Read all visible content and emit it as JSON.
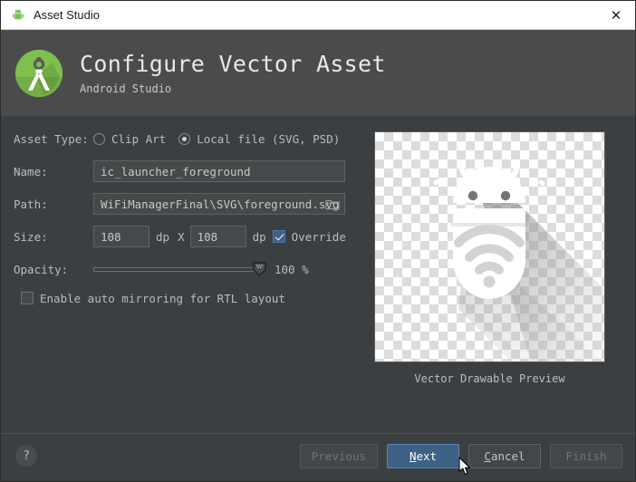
{
  "titlebar": {
    "title": "Asset Studio",
    "icon": "android-robot-icon",
    "close_label": "✕"
  },
  "header": {
    "title": "Configure Vector Asset",
    "subtitle": "Android Studio",
    "logo": "android-studio-logo"
  },
  "form": {
    "asset_type": {
      "label": "Asset Type:",
      "options": [
        {
          "label": "Clip Art",
          "selected": false
        },
        {
          "label": "Local file (SVG, PSD)",
          "selected": true
        }
      ]
    },
    "name": {
      "label": "Name:",
      "value": "ic_launcher_foreground",
      "placeholder": ""
    },
    "path": {
      "label": "Path:",
      "value": "WiFiManagerFinal\\SVG\\foreground.svg",
      "placeholder": "",
      "browse_icon": "folder-icon"
    },
    "size": {
      "label": "Size:",
      "width_value": "108",
      "height_value": "108",
      "unit": "dp",
      "separator": "X",
      "override_label": "Override",
      "override_checked": true
    },
    "opacity": {
      "label": "Opacity:",
      "value": "100 %",
      "percent": 100
    },
    "mirroring": {
      "label": "Enable auto mirroring for RTL layout",
      "checked": false
    }
  },
  "preview": {
    "caption": "Vector Drawable Preview",
    "art": "android-wifi-launcher-foreground"
  },
  "footer": {
    "help_label": "?",
    "buttons": [
      {
        "name": "previous",
        "label": "Previous",
        "mnemonic": "",
        "state": "disabled"
      },
      {
        "name": "next",
        "label": "ext",
        "mnemonic": "N",
        "state": "primary"
      },
      {
        "name": "cancel",
        "label": "ancel",
        "mnemonic": "C",
        "state": "normal"
      },
      {
        "name": "finish",
        "label": "Finish",
        "mnemonic": "",
        "state": "disabled"
      }
    ]
  },
  "colors": {
    "window_bg": "#3c3f41",
    "header_bg": "#4b4b4b",
    "accent_blue": "#3d6185",
    "android_green": "#78c257",
    "text": "#bbbbbb"
  }
}
